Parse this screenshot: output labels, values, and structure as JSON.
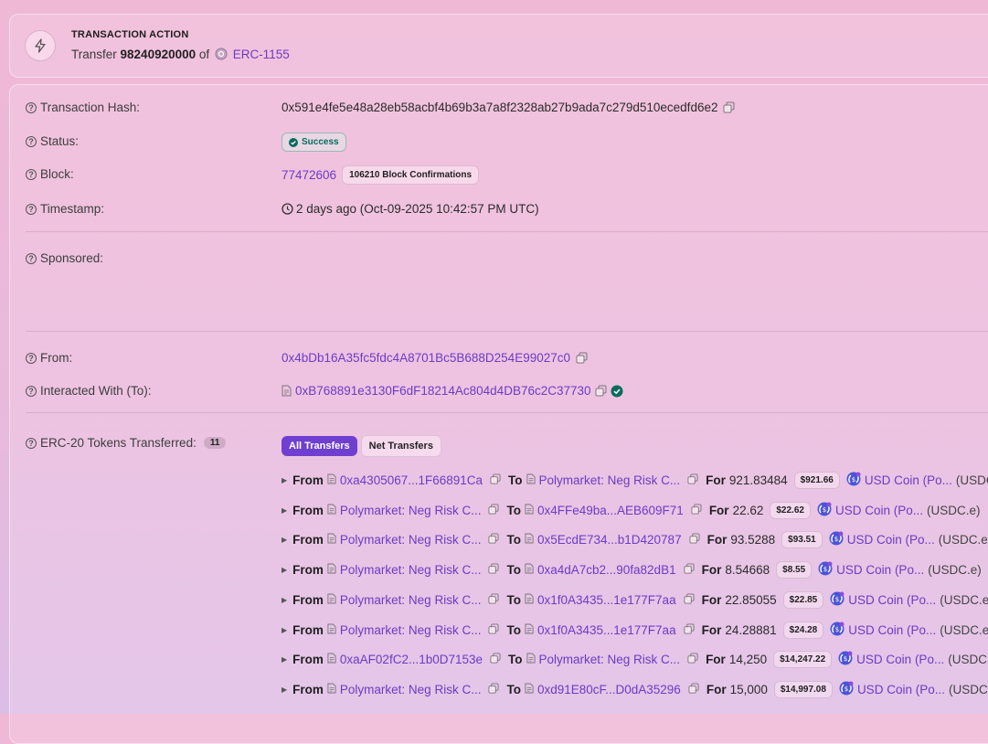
{
  "action": {
    "heading": "TRANSACTION ACTION",
    "verb": "Transfer",
    "amount": "98240920000",
    "of": "of",
    "token": "ERC-1155"
  },
  "fields": {
    "tx_hash": {
      "label": "Transaction Hash:",
      "value": "0x591e4fe5e48a28eb58acbf4b69b3a7a8f2328ab27b9ada7c279d510ecedfd6e2"
    },
    "status": {
      "label": "Status:",
      "value": "Success"
    },
    "block": {
      "label": "Block:",
      "value": "77472606",
      "confirmations": "106210 Block Confirmations"
    },
    "timestamp": {
      "label": "Timestamp:",
      "value": "2 days ago (Oct-09-2025 10:42:57 PM UTC)"
    },
    "sponsored": {
      "label": "Sponsored:"
    },
    "from": {
      "label": "From:",
      "value": "0x4bDb16A35fc5fdc4A8701Bc5B688D254E99027c0"
    },
    "to": {
      "label": "Interacted With (To):",
      "value": "0xB768891e3130F6dF18214Ac804d4DB76c2C37730"
    },
    "erc20": {
      "label": "ERC-20 Tokens Transferred:",
      "count": "11"
    }
  },
  "tabs": {
    "all": "All Transfers",
    "net": "Net Transfers"
  },
  "words": {
    "from": "From",
    "to": "To",
    "for": "For"
  },
  "transfers": [
    {
      "from": "0xa4305067...1F66891Ca",
      "from_contract": true,
      "to": "Polymarket: Neg Risk C...",
      "to_contract": true,
      "amount": "921.83484",
      "usd": "$921.66",
      "token": "USD Coin (Po...",
      "symbol": "(USDC.e)"
    },
    {
      "from": "Polymarket: Neg Risk C...",
      "from_contract": true,
      "to": "0x4FFe49ba...AEB609F71",
      "to_contract": true,
      "amount": "22.62",
      "usd": "$22.62",
      "token": "USD Coin (Po...",
      "symbol": "(USDC.e)"
    },
    {
      "from": "Polymarket: Neg Risk C...",
      "from_contract": true,
      "to": "0x5EcdE734...b1D420787",
      "to_contract": true,
      "amount": "93.5288",
      "usd": "$93.51",
      "token": "USD Coin (Po...",
      "symbol": "(USDC.e)"
    },
    {
      "from": "Polymarket: Neg Risk C...",
      "from_contract": true,
      "to": "0xa4dA7cb2...90fa82dB1",
      "to_contract": true,
      "amount": "8.54668",
      "usd": "$8.55",
      "token": "USD Coin (Po...",
      "symbol": "(USDC.e)"
    },
    {
      "from": "Polymarket: Neg Risk C...",
      "from_contract": true,
      "to": "0x1f0A3435...1e177F7aa",
      "to_contract": true,
      "amount": "22.85055",
      "usd": "$22.85",
      "token": "USD Coin (Po...",
      "symbol": "(USDC.e)"
    },
    {
      "from": "Polymarket: Neg Risk C...",
      "from_contract": true,
      "to": "0x1f0A3435...1e177F7aa",
      "to_contract": true,
      "amount": "24.28881",
      "usd": "$24.28",
      "token": "USD Coin (Po...",
      "symbol": "(USDC.e)"
    },
    {
      "from": "0xaAF02fC2...1b0D7153e",
      "from_contract": true,
      "to": "Polymarket: Neg Risk C...",
      "to_contract": true,
      "amount": "14,250",
      "usd": "$14,247.22",
      "token": "USD Coin (Po...",
      "symbol": "(USDC.e)"
    },
    {
      "from": "Polymarket: Neg Risk C...",
      "from_contract": true,
      "to": "0xd91E80cF...D0dA35296",
      "to_contract": true,
      "amount": "15,000",
      "usd": "$14,997.08",
      "token": "USD Coin (Po...",
      "symbol": "(USDC.e)"
    }
  ],
  "colors": {
    "accent": "#6f3fd0",
    "link": "#6b3cc4",
    "success": "#0b6b5e"
  }
}
